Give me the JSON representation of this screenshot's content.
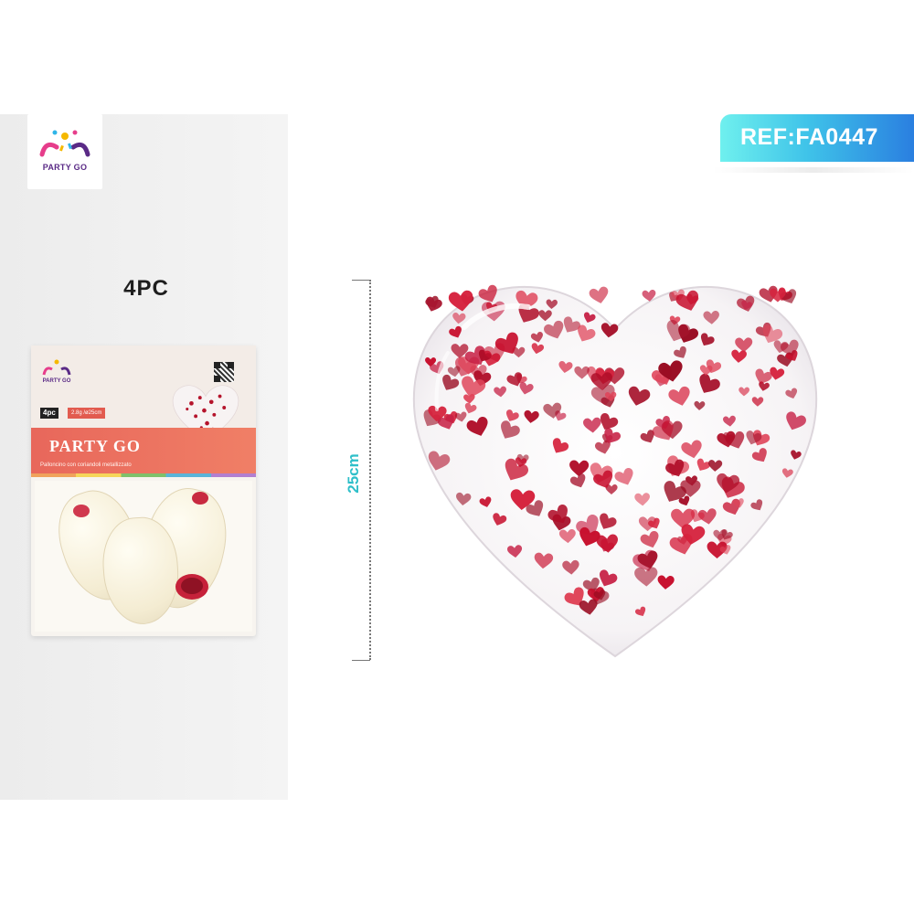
{
  "brand": {
    "name": "PARTY GO"
  },
  "product": {
    "pack_count": "4PC",
    "reference": "REF:FA0447",
    "dimension": "25cm"
  },
  "package": {
    "brand": "PARTY GO",
    "quantity": "4pc",
    "spec": "2.8g /ø25cm",
    "title": "PARTY GO",
    "description": "Palloncino con coriandoli metallizzato"
  },
  "colors": {
    "accent_cyan": "#3fc3e9",
    "accent_blue": "#2a7fe0",
    "confetti_red": "#c8102e",
    "dimension_label": "#2ebfc9",
    "package_band": "#e8675b"
  }
}
